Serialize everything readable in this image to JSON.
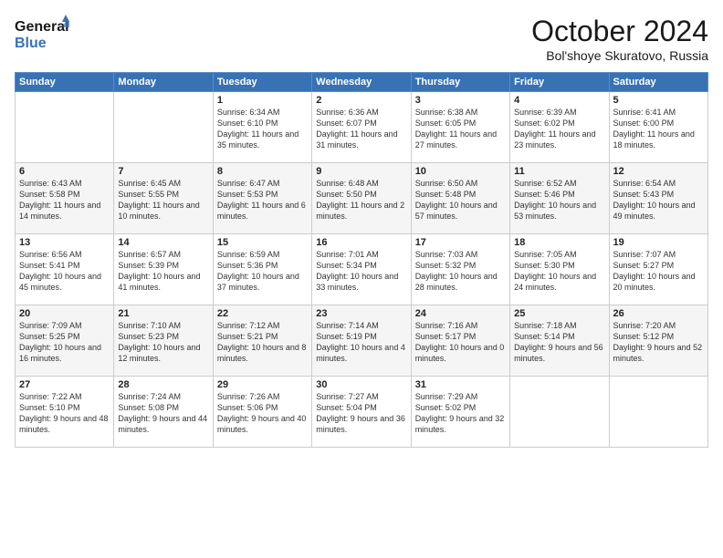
{
  "logo": {
    "line1": "General",
    "line2": "Blue"
  },
  "title": "October 2024",
  "subtitle": "Bol'shoye Skuratovo, Russia",
  "days_header": [
    "Sunday",
    "Monday",
    "Tuesday",
    "Wednesday",
    "Thursday",
    "Friday",
    "Saturday"
  ],
  "weeks": [
    [
      {
        "day": "",
        "sunrise": "",
        "sunset": "",
        "daylight": ""
      },
      {
        "day": "",
        "sunrise": "",
        "sunset": "",
        "daylight": ""
      },
      {
        "day": "1",
        "sunrise": "Sunrise: 6:34 AM",
        "sunset": "Sunset: 6:10 PM",
        "daylight": "Daylight: 11 hours and 35 minutes."
      },
      {
        "day": "2",
        "sunrise": "Sunrise: 6:36 AM",
        "sunset": "Sunset: 6:07 PM",
        "daylight": "Daylight: 11 hours and 31 minutes."
      },
      {
        "day": "3",
        "sunrise": "Sunrise: 6:38 AM",
        "sunset": "Sunset: 6:05 PM",
        "daylight": "Daylight: 11 hours and 27 minutes."
      },
      {
        "day": "4",
        "sunrise": "Sunrise: 6:39 AM",
        "sunset": "Sunset: 6:02 PM",
        "daylight": "Daylight: 11 hours and 23 minutes."
      },
      {
        "day": "5",
        "sunrise": "Sunrise: 6:41 AM",
        "sunset": "Sunset: 6:00 PM",
        "daylight": "Daylight: 11 hours and 18 minutes."
      }
    ],
    [
      {
        "day": "6",
        "sunrise": "Sunrise: 6:43 AM",
        "sunset": "Sunset: 5:58 PM",
        "daylight": "Daylight: 11 hours and 14 minutes."
      },
      {
        "day": "7",
        "sunrise": "Sunrise: 6:45 AM",
        "sunset": "Sunset: 5:55 PM",
        "daylight": "Daylight: 11 hours and 10 minutes."
      },
      {
        "day": "8",
        "sunrise": "Sunrise: 6:47 AM",
        "sunset": "Sunset: 5:53 PM",
        "daylight": "Daylight: 11 hours and 6 minutes."
      },
      {
        "day": "9",
        "sunrise": "Sunrise: 6:48 AM",
        "sunset": "Sunset: 5:50 PM",
        "daylight": "Daylight: 11 hours and 2 minutes."
      },
      {
        "day": "10",
        "sunrise": "Sunrise: 6:50 AM",
        "sunset": "Sunset: 5:48 PM",
        "daylight": "Daylight: 10 hours and 57 minutes."
      },
      {
        "day": "11",
        "sunrise": "Sunrise: 6:52 AM",
        "sunset": "Sunset: 5:46 PM",
        "daylight": "Daylight: 10 hours and 53 minutes."
      },
      {
        "day": "12",
        "sunrise": "Sunrise: 6:54 AM",
        "sunset": "Sunset: 5:43 PM",
        "daylight": "Daylight: 10 hours and 49 minutes."
      }
    ],
    [
      {
        "day": "13",
        "sunrise": "Sunrise: 6:56 AM",
        "sunset": "Sunset: 5:41 PM",
        "daylight": "Daylight: 10 hours and 45 minutes."
      },
      {
        "day": "14",
        "sunrise": "Sunrise: 6:57 AM",
        "sunset": "Sunset: 5:39 PM",
        "daylight": "Daylight: 10 hours and 41 minutes."
      },
      {
        "day": "15",
        "sunrise": "Sunrise: 6:59 AM",
        "sunset": "Sunset: 5:36 PM",
        "daylight": "Daylight: 10 hours and 37 minutes."
      },
      {
        "day": "16",
        "sunrise": "Sunrise: 7:01 AM",
        "sunset": "Sunset: 5:34 PM",
        "daylight": "Daylight: 10 hours and 33 minutes."
      },
      {
        "day": "17",
        "sunrise": "Sunrise: 7:03 AM",
        "sunset": "Sunset: 5:32 PM",
        "daylight": "Daylight: 10 hours and 28 minutes."
      },
      {
        "day": "18",
        "sunrise": "Sunrise: 7:05 AM",
        "sunset": "Sunset: 5:30 PM",
        "daylight": "Daylight: 10 hours and 24 minutes."
      },
      {
        "day": "19",
        "sunrise": "Sunrise: 7:07 AM",
        "sunset": "Sunset: 5:27 PM",
        "daylight": "Daylight: 10 hours and 20 minutes."
      }
    ],
    [
      {
        "day": "20",
        "sunrise": "Sunrise: 7:09 AM",
        "sunset": "Sunset: 5:25 PM",
        "daylight": "Daylight: 10 hours and 16 minutes."
      },
      {
        "day": "21",
        "sunrise": "Sunrise: 7:10 AM",
        "sunset": "Sunset: 5:23 PM",
        "daylight": "Daylight: 10 hours and 12 minutes."
      },
      {
        "day": "22",
        "sunrise": "Sunrise: 7:12 AM",
        "sunset": "Sunset: 5:21 PM",
        "daylight": "Daylight: 10 hours and 8 minutes."
      },
      {
        "day": "23",
        "sunrise": "Sunrise: 7:14 AM",
        "sunset": "Sunset: 5:19 PM",
        "daylight": "Daylight: 10 hours and 4 minutes."
      },
      {
        "day": "24",
        "sunrise": "Sunrise: 7:16 AM",
        "sunset": "Sunset: 5:17 PM",
        "daylight": "Daylight: 10 hours and 0 minutes."
      },
      {
        "day": "25",
        "sunrise": "Sunrise: 7:18 AM",
        "sunset": "Sunset: 5:14 PM",
        "daylight": "Daylight: 9 hours and 56 minutes."
      },
      {
        "day": "26",
        "sunrise": "Sunrise: 7:20 AM",
        "sunset": "Sunset: 5:12 PM",
        "daylight": "Daylight: 9 hours and 52 minutes."
      }
    ],
    [
      {
        "day": "27",
        "sunrise": "Sunrise: 7:22 AM",
        "sunset": "Sunset: 5:10 PM",
        "daylight": "Daylight: 9 hours and 48 minutes."
      },
      {
        "day": "28",
        "sunrise": "Sunrise: 7:24 AM",
        "sunset": "Sunset: 5:08 PM",
        "daylight": "Daylight: 9 hours and 44 minutes."
      },
      {
        "day": "29",
        "sunrise": "Sunrise: 7:26 AM",
        "sunset": "Sunset: 5:06 PM",
        "daylight": "Daylight: 9 hours and 40 minutes."
      },
      {
        "day": "30",
        "sunrise": "Sunrise: 7:27 AM",
        "sunset": "Sunset: 5:04 PM",
        "daylight": "Daylight: 9 hours and 36 minutes."
      },
      {
        "day": "31",
        "sunrise": "Sunrise: 7:29 AM",
        "sunset": "Sunset: 5:02 PM",
        "daylight": "Daylight: 9 hours and 32 minutes."
      },
      {
        "day": "",
        "sunrise": "",
        "sunset": "",
        "daylight": ""
      },
      {
        "day": "",
        "sunrise": "",
        "sunset": "",
        "daylight": ""
      }
    ]
  ]
}
